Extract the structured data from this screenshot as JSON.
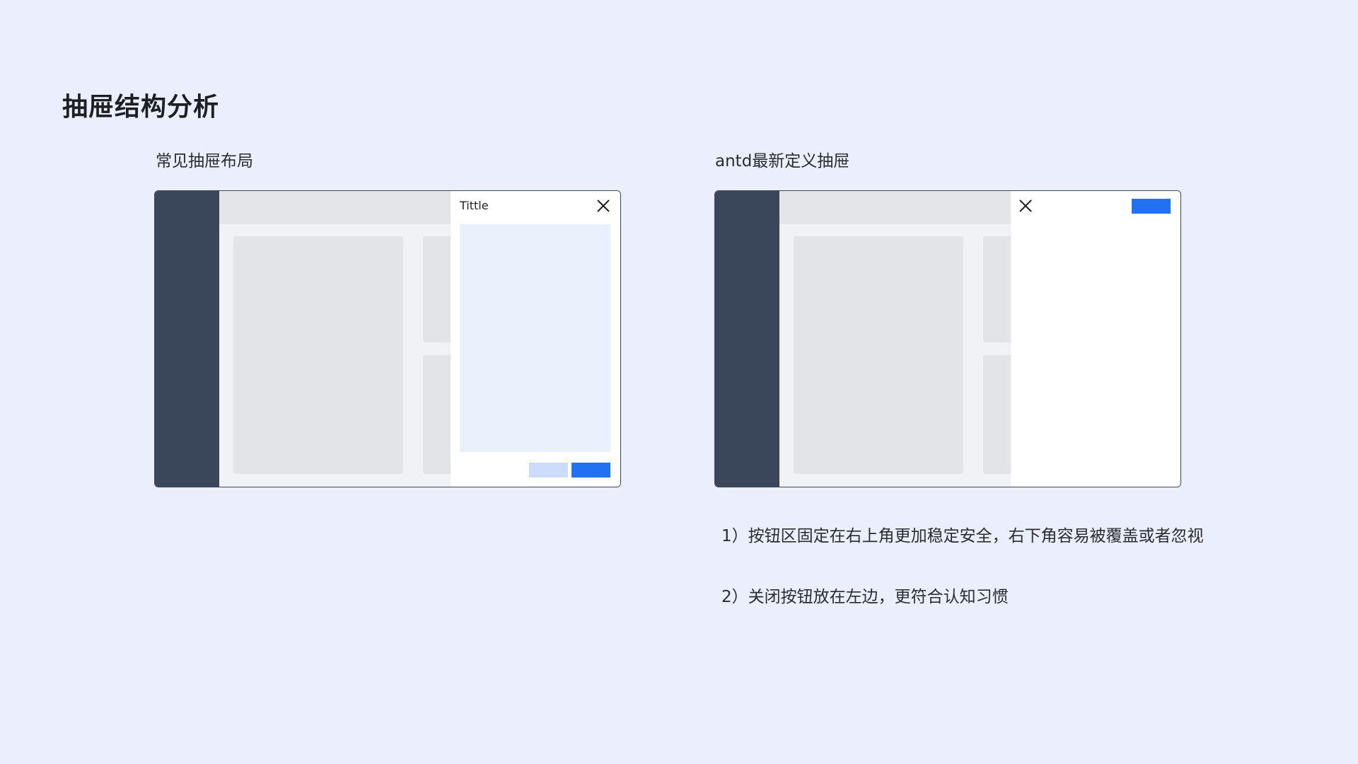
{
  "page": {
    "title": "抽屉结构分析"
  },
  "left_example": {
    "label": "常见抽屉布局",
    "drawer": {
      "title": "Tittle",
      "close_icon": "close-icon",
      "buttons": [
        "secondary",
        "primary"
      ]
    }
  },
  "right_example": {
    "label": "antd最新定义抽屉",
    "drawer": {
      "close_icon": "close-icon",
      "buttons": [
        "primary"
      ]
    }
  },
  "notes": [
    "1）按钮区固定在右上角更加稳定安全，右下角容易被覆盖或者忽视",
    "2）关闭按钮放在左边，更符合认知习惯"
  ],
  "colors": {
    "background": "#eaeefd",
    "sidebar": "#3a4659",
    "placeholder": "#e2e4e8",
    "drawer_content": "#eaf1fd",
    "primary": "#2271f2",
    "secondary": "#cddcfa"
  }
}
